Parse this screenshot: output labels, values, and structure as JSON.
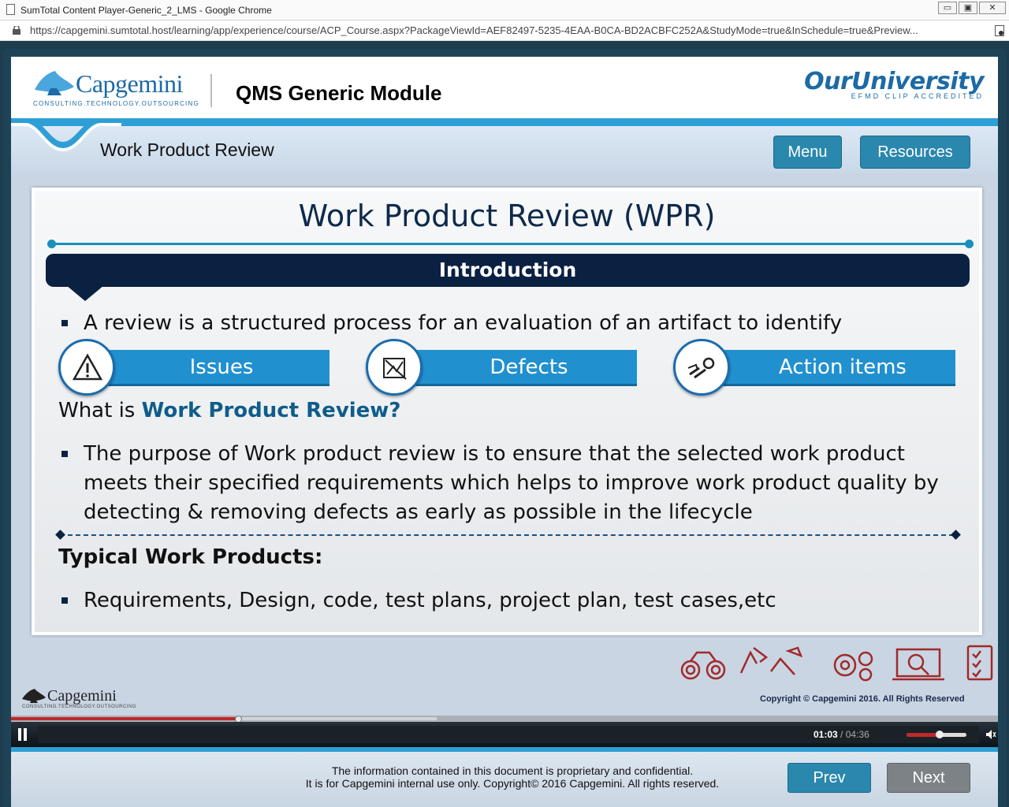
{
  "browser": {
    "title": "SumTotal Content Player-Generic_2_LMS - Google Chrome",
    "url": "https://capgemini.sumtotal.host/learning/app/experience/course/ACP_Course.aspx?PackageViewId=AEF82497-5235-4EAA-B0CA-BD2ACBFC252A&StudyMode=true&InSchedule=true&Preview..."
  },
  "header": {
    "logo_word": "Capgemini",
    "logo_tagline": "CONSULTING.TECHNOLOGY.OUTSOURCING",
    "module_title": "QMS Generic Module",
    "univ_word": "OurUniversity",
    "univ_tag": "EFMD CLIP ACCREDITED"
  },
  "subheader": {
    "section_title": "Work Product Review",
    "menu_label": "Menu",
    "resources_label": "Resources"
  },
  "slide": {
    "title": "Work Product Review (WPR)",
    "intro_label": "Introduction",
    "bullet1": "A review is a structured process for an evaluation of an artifact to identify",
    "pills": [
      "Issues",
      "Defects",
      "Action items"
    ],
    "what_prefix": "What is ",
    "what_bold": "Work Product Review?",
    "bullet2": "The purpose of Work product review is to ensure that the selected work product meets their specified requirements which helps to improve work product quality by detecting & removing defects as early as possible in the lifecycle",
    "typical_heading": "Typical Work Products:",
    "bullet3": "Requirements, Design, code, test plans, project plan, test cases,etc"
  },
  "footer": {
    "logo_word": "Capgemini",
    "logo_tagline": "CONSULTING.TECHNOLOGY.OUTSOURCING",
    "copyright": "Copyright © Capgemini 2016. All Rights Reserved"
  },
  "player": {
    "current_time": "01:03",
    "separator": " / ",
    "total_time": "04:36",
    "progress_fraction": 0.23,
    "volume_fraction": 0.55
  },
  "bottom": {
    "notice_line1": "The information contained in this document is proprietary and confidential.",
    "notice_line2": "It is for Capgemini internal use only. Copyright© 2016 Capgemini. All rights reserved.",
    "prev_label": "Prev",
    "next_label": "Next"
  },
  "colors": {
    "accent_blue": "#2190cf",
    "navy": "#0a2142",
    "button_teal": "#2a87ad",
    "next_gray": "#7d8287",
    "progress_red": "#c0282c"
  }
}
